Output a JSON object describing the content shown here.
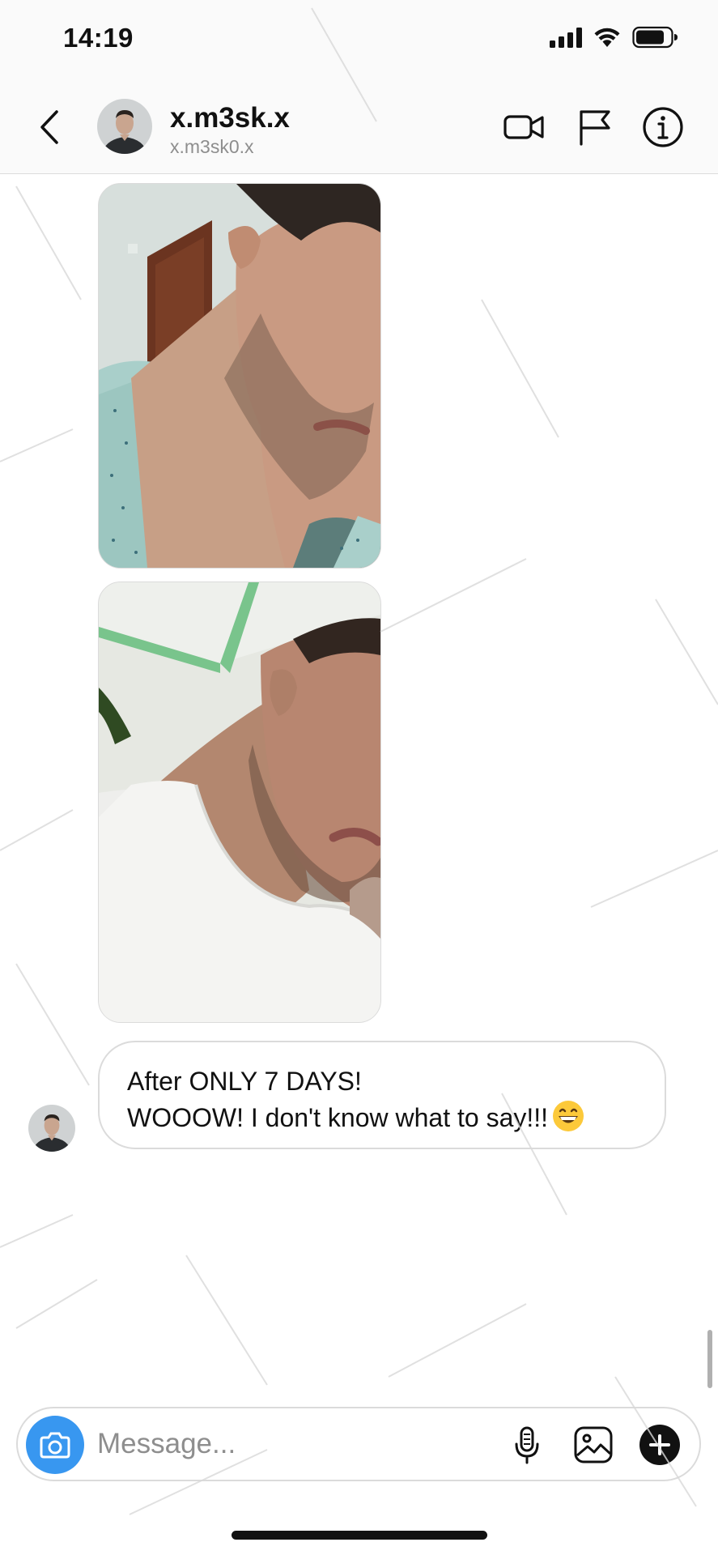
{
  "status_bar": {
    "time": "14:19",
    "icons": [
      "signal-icon",
      "wifi-icon",
      "battery-icon"
    ]
  },
  "header": {
    "username": "x.m3sk.x",
    "subtitle": "x.m3sk0.x",
    "icons": [
      "back-arrow-icon",
      "video-call-icon",
      "flag-icon",
      "info-icon"
    ]
  },
  "messages": [
    {
      "type": "photo",
      "description_icon": "photo-message"
    },
    {
      "type": "photo",
      "description_icon": "photo-message"
    },
    {
      "type": "text",
      "lines": [
        "After ONLY 7 DAYS!",
        "WOOOW! I don't know what to say!!!"
      ],
      "emoji": "grinning-face-icon"
    }
  ],
  "composer": {
    "placeholder": "Message...",
    "icons": [
      "camera-icon",
      "microphone-icon",
      "gallery-icon",
      "plus-icon"
    ]
  },
  "colors": {
    "accent": "#3897f0",
    "border": "#dbdbdb",
    "secondary_text": "#8e8e8e"
  }
}
